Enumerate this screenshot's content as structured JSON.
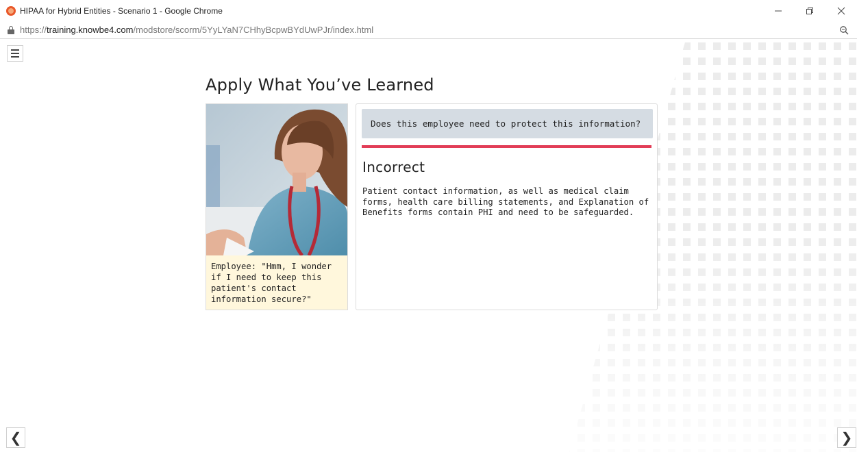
{
  "browser": {
    "window_title": "HIPAA for Hybrid Entities - Scenario 1 - Google Chrome",
    "url_prefix": "https://",
    "url_host": "training.knowbe4.com",
    "url_path": "/modstore/scorm/5YyLYaN7CHhyBcpwBYdUwPJr/index.html"
  },
  "page": {
    "heading": "Apply What You’ve Learned",
    "caption": "Employee: \"Hmm, I wonder if I need to keep this patient's contact information secure?\"",
    "question": "Does this employee need to protect this information?",
    "result_title": "Incorrect",
    "result_text": "Patient contact information, as well as medical claim forms, health care billing statements, and Explanation of Benefits forms contain PHI and need to be safeguarded."
  },
  "nav": {
    "prev_glyph": "❮",
    "next_glyph": "❯"
  },
  "icons": {
    "favicon": "knowbe4-favicon",
    "menu": "hamburger-menu-icon",
    "lock": "lock-icon",
    "zoom": "zoom-icon"
  },
  "colors": {
    "accent_red": "#e23d57",
    "question_bg": "#d5dce3",
    "caption_bg": "#fff7dc"
  }
}
